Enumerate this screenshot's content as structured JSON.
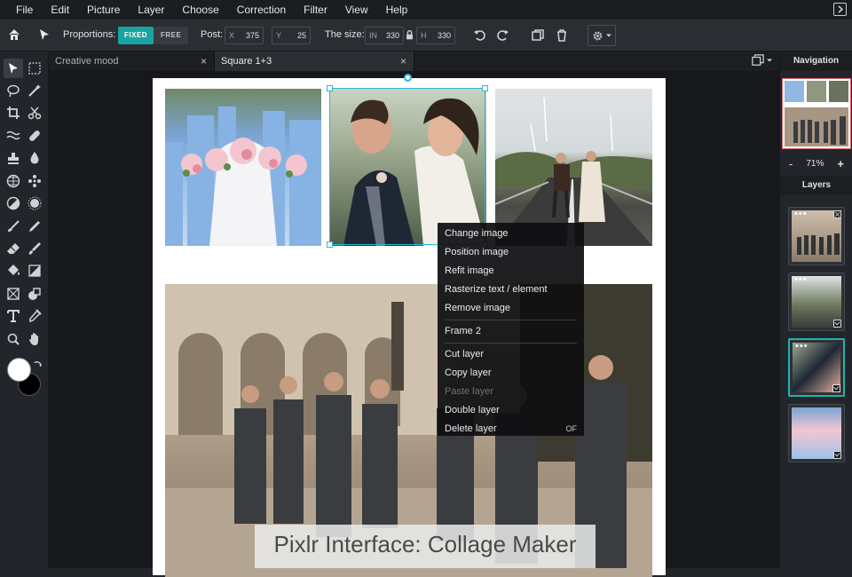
{
  "menubar": {
    "items": [
      "File",
      "Edit",
      "Picture",
      "Layer",
      "Choose",
      "Correction",
      "Filter",
      "View",
      "Help"
    ]
  },
  "toolbar": {
    "proportions_label": "Proportions:",
    "fixed_label": "FIXED",
    "free_label": "FREE",
    "post_label": "Post:",
    "x_label": "X",
    "x_value": "375",
    "y_label": "Y",
    "y_value": "25",
    "size_label": "The size:",
    "in_label": "IN",
    "in_value": "330",
    "h_label": "H",
    "h_value": "330"
  },
  "tabs": [
    {
      "label": "Creative mood",
      "close": "×"
    },
    {
      "label": "Square 1+3",
      "close": "×"
    }
  ],
  "context_menu": {
    "group1": [
      "Change image",
      "Position image",
      "Refit image",
      "Rasterize text / element",
      "Remove image"
    ],
    "group2": [
      "Frame 2"
    ],
    "group3": [
      {
        "label": "Cut layer",
        "disabled": false
      },
      {
        "label": "Copy layer",
        "disabled": false
      },
      {
        "label": "Paste layer",
        "disabled": true
      },
      {
        "label": "Double layer",
        "disabled": false
      },
      {
        "label": "Delete layer",
        "shortcut": "OF",
        "disabled": false
      }
    ]
  },
  "caption": "Pixlr Interface: Collage Maker",
  "right_panel": {
    "navigation_title": "Navigation",
    "zoom_minus": "-",
    "zoom_value": "71%",
    "zoom_plus": "+",
    "layers_title": "Layers"
  },
  "colors": {
    "accent": "#1aa3a3",
    "selection": "#32b4d8",
    "foreground": "#ffffff",
    "background": "#000000"
  }
}
